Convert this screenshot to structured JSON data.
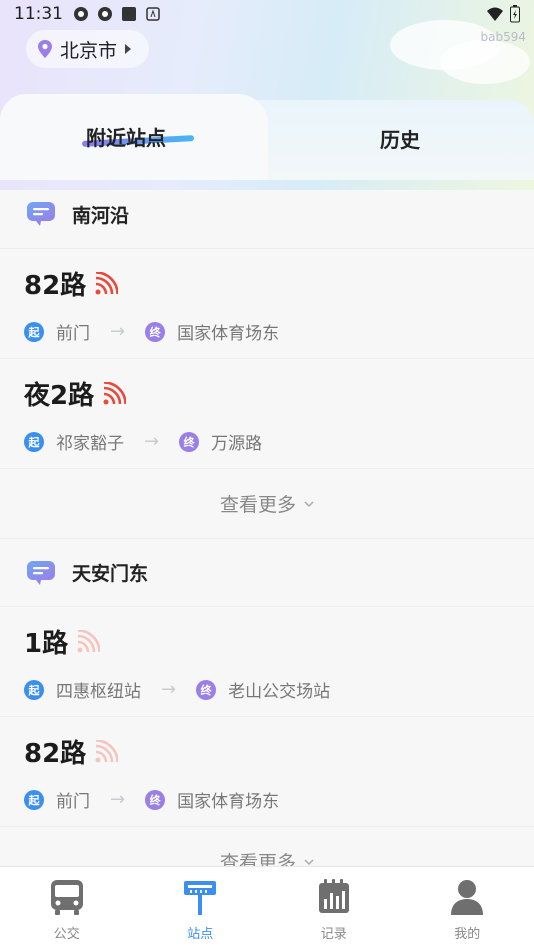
{
  "status_bar": {
    "time": "11:31"
  },
  "watermark": "bab594",
  "city": "北京市",
  "tabs": [
    {
      "label": "附近站点",
      "active": true
    },
    {
      "label": "历史",
      "active": false
    }
  ],
  "stations": [
    {
      "name": "南河沿",
      "routes": [
        {
          "name": "82路",
          "start": "前门",
          "end": "国家体育场东",
          "signal": "strong"
        },
        {
          "name": "夜2路",
          "start": "祁家豁子",
          "end": "万源路",
          "signal": "strong"
        }
      ],
      "more_label": "查看更多"
    },
    {
      "name": "天安门东",
      "routes": [
        {
          "name": "1路",
          "start": "四惠枢纽站",
          "end": "老山公交场站",
          "signal": "weak"
        },
        {
          "name": "82路",
          "start": "前门",
          "end": "国家体育场东",
          "signal": "weak"
        }
      ],
      "more_label": "查看更多"
    }
  ],
  "badges": {
    "start": "起",
    "end": "终"
  },
  "colors": {
    "accent": "#3b8ff0",
    "signal_strong": "#e8493c",
    "signal_weak": "#f6c4bf",
    "end_badge": "#9a7fe6"
  },
  "bottom_nav": [
    {
      "label": "公交",
      "icon": "bus-icon",
      "active": false
    },
    {
      "label": "站点",
      "icon": "bus-stop-icon",
      "active": true
    },
    {
      "label": "记录",
      "icon": "record-icon",
      "active": false
    },
    {
      "label": "我的",
      "icon": "user-icon",
      "active": false
    }
  ]
}
